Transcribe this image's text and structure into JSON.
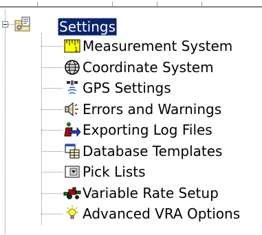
{
  "tree": {
    "root": {
      "label": "Settings",
      "icon": "settings-folder-icon",
      "expander": "minus",
      "selected": true
    },
    "items": [
      {
        "label": "Measurement System",
        "icon": "ruler-icon"
      },
      {
        "label": "Coordinate System",
        "icon": "globe-icon"
      },
      {
        "label": "GPS Settings",
        "icon": "satellite-icon"
      },
      {
        "label": "Errors and Warnings",
        "icon": "speaker-icon"
      },
      {
        "label": "Exporting Log Files",
        "icon": "export-icon"
      },
      {
        "label": "Database Templates",
        "icon": "database-template-icon"
      },
      {
        "label": "Pick Lists",
        "icon": "dropdown-list-icon"
      },
      {
        "label": "Variable Rate Setup",
        "icon": "tractor-icon"
      },
      {
        "label": "Advanced VRA Options",
        "icon": "lightbulb-icon"
      }
    ]
  },
  "colors": {
    "selection_bg": "#0a246a",
    "selection_text": "#ffffff",
    "tree_lines": "#808080"
  }
}
